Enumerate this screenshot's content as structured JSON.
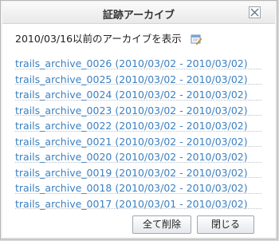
{
  "dialog": {
    "title": "証跡アーカイブ",
    "description": "2010/03/16以前のアーカイブを表示"
  },
  "archives": [
    "trails_archive_0026 (2010/03/02 - 2010/03/02)",
    "trails_archive_0025 (2010/03/02 - 2010/03/02)",
    "trails_archive_0024 (2010/03/02 - 2010/03/02)",
    "trails_archive_0023 (2010/03/02 - 2010/03/02)",
    "trails_archive_0022 (2010/03/02 - 2010/03/02)",
    "trails_archive_0021 (2010/03/02 - 2010/03/02)",
    "trails_archive_0020 (2010/03/02 - 2010/03/02)",
    "trails_archive_0019 (2010/03/02 - 2010/03/02)",
    "trails_archive_0018 (2010/03/02 - 2010/03/02)",
    "trails_archive_0017 (2010/03/01 - 2010/03/02)"
  ],
  "buttons": {
    "delete_all": "全て削除",
    "close": "閉じる"
  },
  "icons": {
    "close": "close-icon",
    "description": "edit-calendar-icon"
  },
  "colors": {
    "link": "#3c80c0"
  }
}
